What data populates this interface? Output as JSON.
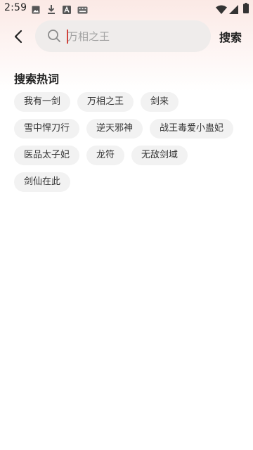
{
  "status_bar": {
    "time": "2:59",
    "left_icons": [
      "image-icon",
      "download-icon",
      "app-icon",
      "keyboard-icon"
    ],
    "right_icons": [
      "wifi-icon",
      "cellular-icon",
      "battery-icon"
    ]
  },
  "search": {
    "placeholder": "万相之王",
    "button_label": "搜索"
  },
  "hot_words": {
    "title": "搜索热词",
    "items": [
      "我有一剑",
      "万相之王",
      "剑来",
      "雪中悍刀行",
      "逆天邪神",
      "战王毒爱小蛊妃",
      "医品太子妃",
      "龙符",
      "无敌剑域",
      "剑仙在此"
    ]
  },
  "colors": {
    "accent_caret": "#d1433c",
    "tag_bg": "#f2f2f2",
    "search_bg": "#efeceb"
  }
}
